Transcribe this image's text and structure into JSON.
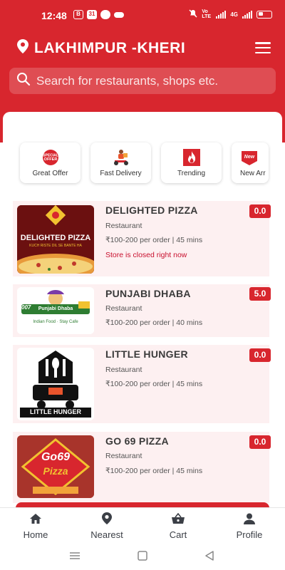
{
  "status_bar": {
    "time": "12:48",
    "left_icons": [
      "B",
      "31"
    ],
    "network_label": "Vo LTE",
    "net_gen": "4G"
  },
  "header": {
    "location": "LAKHIMPUR -KHERI"
  },
  "search": {
    "placeholder": "Search for restaurants, shops etc."
  },
  "categories": [
    {
      "label": "Great Offer",
      "icon": "special-offer-badge-icon"
    },
    {
      "label": "Fast Delivery",
      "icon": "delivery-scooter-icon"
    },
    {
      "label": "Trending",
      "icon": "flame-icon"
    },
    {
      "label": "New Arr",
      "icon": "new-ribbon-icon"
    }
  ],
  "restaurants": [
    {
      "name": "DELIGHTED PIZZA",
      "type": "Restaurant",
      "price_time": "₹100-200 per order | 45 mins",
      "status": "Store is closed right now",
      "rating": "0.0",
      "logo_text": "DELIGHTED PIZZA",
      "logo_tagline": "KUCH RISTE DIL SE BANTE HA"
    },
    {
      "name": "PUNJABI DHABA",
      "type": "Restaurant",
      "price_time": "₹100-200 per order | 40 mins",
      "status": "",
      "rating": "5.0",
      "logo_text": "Punjabi Dhaba",
      "logo_tagline": "Indian Food · Stay Cafe",
      "logo_badge": "007"
    },
    {
      "name": "LITTLE HUNGER",
      "type": "Restaurant",
      "price_time": "₹100-200 per order | 45 mins",
      "status": "",
      "rating": "0.0",
      "logo_text": "LITTLE HUNGER"
    },
    {
      "name": "GO 69 PIZZA",
      "type": "Restaurant",
      "price_time": "₹100-200 per order | 45 mins",
      "status": "",
      "rating": "0.0",
      "logo_text": "Go69",
      "logo_sub": "Pizza"
    }
  ],
  "bottom_nav": [
    {
      "label": "Home",
      "icon": "home-icon"
    },
    {
      "label": "Nearest",
      "icon": "location-pin-icon"
    },
    {
      "label": "Cart",
      "icon": "basket-icon"
    },
    {
      "label": "Profile",
      "icon": "person-icon"
    }
  ],
  "colors": {
    "brand": "#d8262e",
    "card_bg": "#fdf0f1",
    "closed_text": "#c8102e"
  }
}
